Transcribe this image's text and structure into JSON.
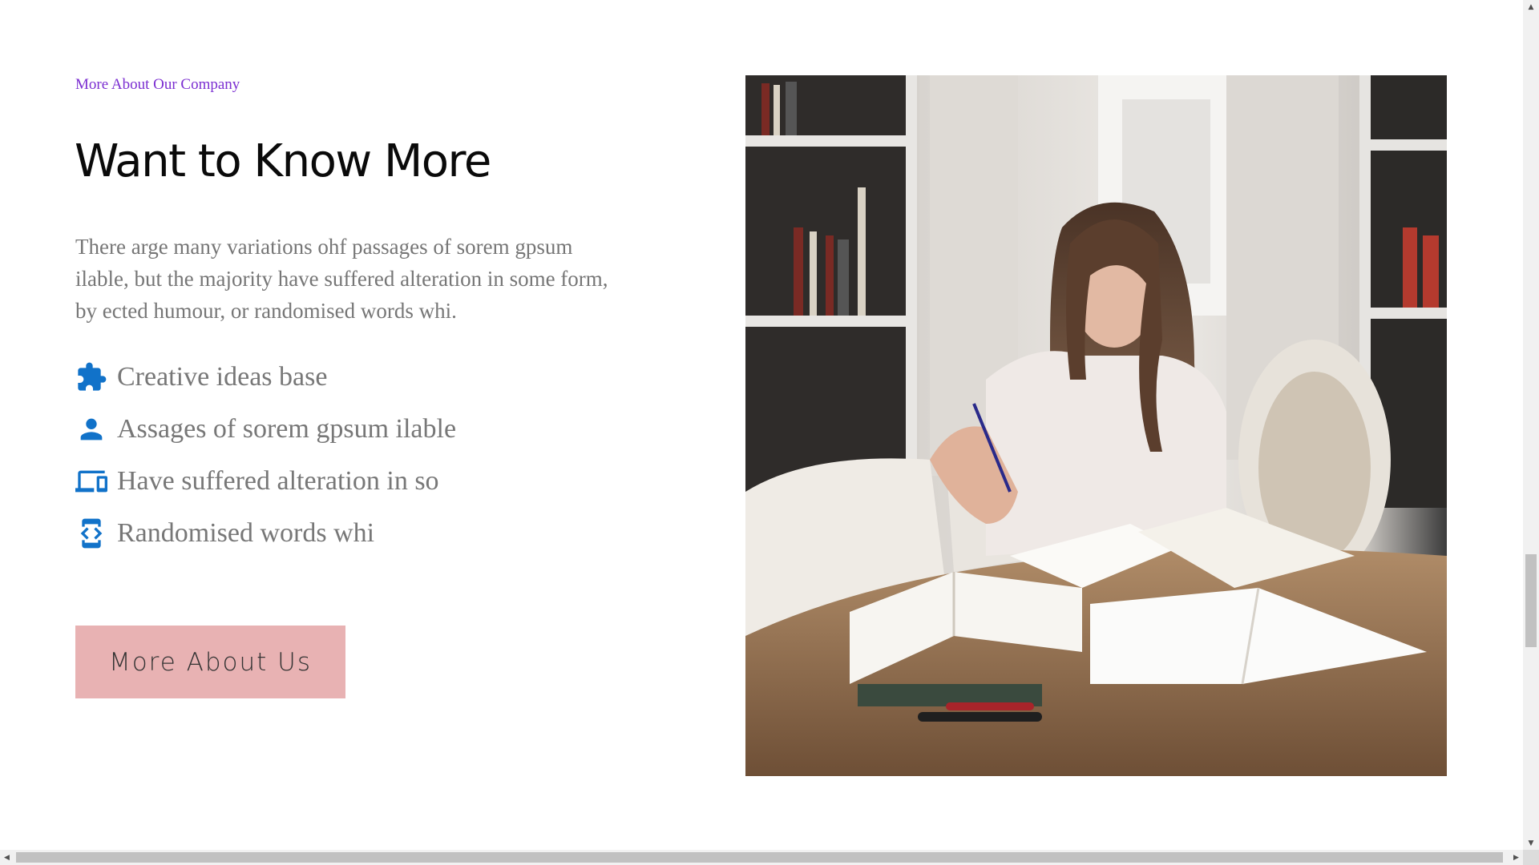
{
  "section": {
    "eyebrow": "More About Our Company",
    "title": "Want to Know More",
    "description": "There arge many variations ohf passages of sorem gpsum ilable, but the majority have suffered alteration in some form, by ected humour, or randomised words whi.",
    "features": [
      {
        "icon": "puzzle-icon",
        "label": "Creative ideas base"
      },
      {
        "icon": "person-icon",
        "label": "Assages of sorem gpsum ilable"
      },
      {
        "icon": "devices-icon",
        "label": "Have suffered alteration in so"
      },
      {
        "icon": "developer-mode-icon",
        "label": "Randomised words whi"
      }
    ],
    "cta_label": "More About Us",
    "image_description": "Photo of a girl studying with open books at a table"
  },
  "colors": {
    "eyebrow": "#7b2ed1",
    "heading": "#0a0a0a",
    "body_text": "#767676",
    "icon_blue": "#1172c9",
    "cta_background": "#e8b2b3"
  },
  "scrollbars": {
    "vertical_arrow_up": "▲",
    "vertical_arrow_down": "▼",
    "horizontal_arrow_left": "◀",
    "horizontal_arrow_right": "▶"
  }
}
